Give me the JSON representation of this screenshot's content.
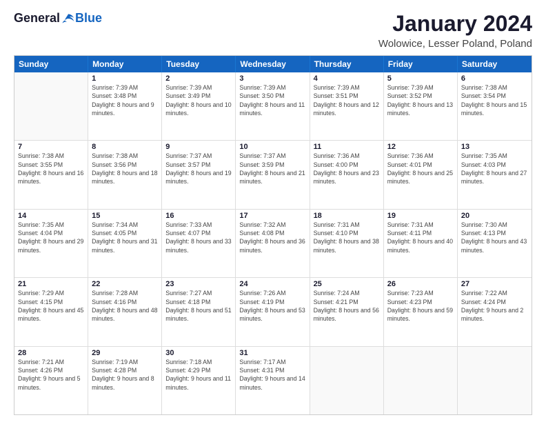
{
  "logo": {
    "general": "General",
    "blue": "Blue"
  },
  "title": "January 2024",
  "location": "Wolowice, Lesser Poland, Poland",
  "days": [
    "Sunday",
    "Monday",
    "Tuesday",
    "Wednesday",
    "Thursday",
    "Friday",
    "Saturday"
  ],
  "rows": [
    [
      {
        "date": "",
        "sunrise": "",
        "sunset": "",
        "daylight": ""
      },
      {
        "date": "1",
        "sunrise": "Sunrise: 7:39 AM",
        "sunset": "Sunset: 3:48 PM",
        "daylight": "Daylight: 8 hours and 9 minutes."
      },
      {
        "date": "2",
        "sunrise": "Sunrise: 7:39 AM",
        "sunset": "Sunset: 3:49 PM",
        "daylight": "Daylight: 8 hours and 10 minutes."
      },
      {
        "date": "3",
        "sunrise": "Sunrise: 7:39 AM",
        "sunset": "Sunset: 3:50 PM",
        "daylight": "Daylight: 8 hours and 11 minutes."
      },
      {
        "date": "4",
        "sunrise": "Sunrise: 7:39 AM",
        "sunset": "Sunset: 3:51 PM",
        "daylight": "Daylight: 8 hours and 12 minutes."
      },
      {
        "date": "5",
        "sunrise": "Sunrise: 7:39 AM",
        "sunset": "Sunset: 3:52 PM",
        "daylight": "Daylight: 8 hours and 13 minutes."
      },
      {
        "date": "6",
        "sunrise": "Sunrise: 7:38 AM",
        "sunset": "Sunset: 3:54 PM",
        "daylight": "Daylight: 8 hours and 15 minutes."
      }
    ],
    [
      {
        "date": "7",
        "sunrise": "Sunrise: 7:38 AM",
        "sunset": "Sunset: 3:55 PM",
        "daylight": "Daylight: 8 hours and 16 minutes."
      },
      {
        "date": "8",
        "sunrise": "Sunrise: 7:38 AM",
        "sunset": "Sunset: 3:56 PM",
        "daylight": "Daylight: 8 hours and 18 minutes."
      },
      {
        "date": "9",
        "sunrise": "Sunrise: 7:37 AM",
        "sunset": "Sunset: 3:57 PM",
        "daylight": "Daylight: 8 hours and 19 minutes."
      },
      {
        "date": "10",
        "sunrise": "Sunrise: 7:37 AM",
        "sunset": "Sunset: 3:59 PM",
        "daylight": "Daylight: 8 hours and 21 minutes."
      },
      {
        "date": "11",
        "sunrise": "Sunrise: 7:36 AM",
        "sunset": "Sunset: 4:00 PM",
        "daylight": "Daylight: 8 hours and 23 minutes."
      },
      {
        "date": "12",
        "sunrise": "Sunrise: 7:36 AM",
        "sunset": "Sunset: 4:01 PM",
        "daylight": "Daylight: 8 hours and 25 minutes."
      },
      {
        "date": "13",
        "sunrise": "Sunrise: 7:35 AM",
        "sunset": "Sunset: 4:03 PM",
        "daylight": "Daylight: 8 hours and 27 minutes."
      }
    ],
    [
      {
        "date": "14",
        "sunrise": "Sunrise: 7:35 AM",
        "sunset": "Sunset: 4:04 PM",
        "daylight": "Daylight: 8 hours and 29 minutes."
      },
      {
        "date": "15",
        "sunrise": "Sunrise: 7:34 AM",
        "sunset": "Sunset: 4:05 PM",
        "daylight": "Daylight: 8 hours and 31 minutes."
      },
      {
        "date": "16",
        "sunrise": "Sunrise: 7:33 AM",
        "sunset": "Sunset: 4:07 PM",
        "daylight": "Daylight: 8 hours and 33 minutes."
      },
      {
        "date": "17",
        "sunrise": "Sunrise: 7:32 AM",
        "sunset": "Sunset: 4:08 PM",
        "daylight": "Daylight: 8 hours and 36 minutes."
      },
      {
        "date": "18",
        "sunrise": "Sunrise: 7:31 AM",
        "sunset": "Sunset: 4:10 PM",
        "daylight": "Daylight: 8 hours and 38 minutes."
      },
      {
        "date": "19",
        "sunrise": "Sunrise: 7:31 AM",
        "sunset": "Sunset: 4:11 PM",
        "daylight": "Daylight: 8 hours and 40 minutes."
      },
      {
        "date": "20",
        "sunrise": "Sunrise: 7:30 AM",
        "sunset": "Sunset: 4:13 PM",
        "daylight": "Daylight: 8 hours and 43 minutes."
      }
    ],
    [
      {
        "date": "21",
        "sunrise": "Sunrise: 7:29 AM",
        "sunset": "Sunset: 4:15 PM",
        "daylight": "Daylight: 8 hours and 45 minutes."
      },
      {
        "date": "22",
        "sunrise": "Sunrise: 7:28 AM",
        "sunset": "Sunset: 4:16 PM",
        "daylight": "Daylight: 8 hours and 48 minutes."
      },
      {
        "date": "23",
        "sunrise": "Sunrise: 7:27 AM",
        "sunset": "Sunset: 4:18 PM",
        "daylight": "Daylight: 8 hours and 51 minutes."
      },
      {
        "date": "24",
        "sunrise": "Sunrise: 7:26 AM",
        "sunset": "Sunset: 4:19 PM",
        "daylight": "Daylight: 8 hours and 53 minutes."
      },
      {
        "date": "25",
        "sunrise": "Sunrise: 7:24 AM",
        "sunset": "Sunset: 4:21 PM",
        "daylight": "Daylight: 8 hours and 56 minutes."
      },
      {
        "date": "26",
        "sunrise": "Sunrise: 7:23 AM",
        "sunset": "Sunset: 4:23 PM",
        "daylight": "Daylight: 8 hours and 59 minutes."
      },
      {
        "date": "27",
        "sunrise": "Sunrise: 7:22 AM",
        "sunset": "Sunset: 4:24 PM",
        "daylight": "Daylight: 9 hours and 2 minutes."
      }
    ],
    [
      {
        "date": "28",
        "sunrise": "Sunrise: 7:21 AM",
        "sunset": "Sunset: 4:26 PM",
        "daylight": "Daylight: 9 hours and 5 minutes."
      },
      {
        "date": "29",
        "sunrise": "Sunrise: 7:19 AM",
        "sunset": "Sunset: 4:28 PM",
        "daylight": "Daylight: 9 hours and 8 minutes."
      },
      {
        "date": "30",
        "sunrise": "Sunrise: 7:18 AM",
        "sunset": "Sunset: 4:29 PM",
        "daylight": "Daylight: 9 hours and 11 minutes."
      },
      {
        "date": "31",
        "sunrise": "Sunrise: 7:17 AM",
        "sunset": "Sunset: 4:31 PM",
        "daylight": "Daylight: 9 hours and 14 minutes."
      },
      {
        "date": "",
        "sunrise": "",
        "sunset": "",
        "daylight": ""
      },
      {
        "date": "",
        "sunrise": "",
        "sunset": "",
        "daylight": ""
      },
      {
        "date": "",
        "sunrise": "",
        "sunset": "",
        "daylight": ""
      }
    ]
  ]
}
